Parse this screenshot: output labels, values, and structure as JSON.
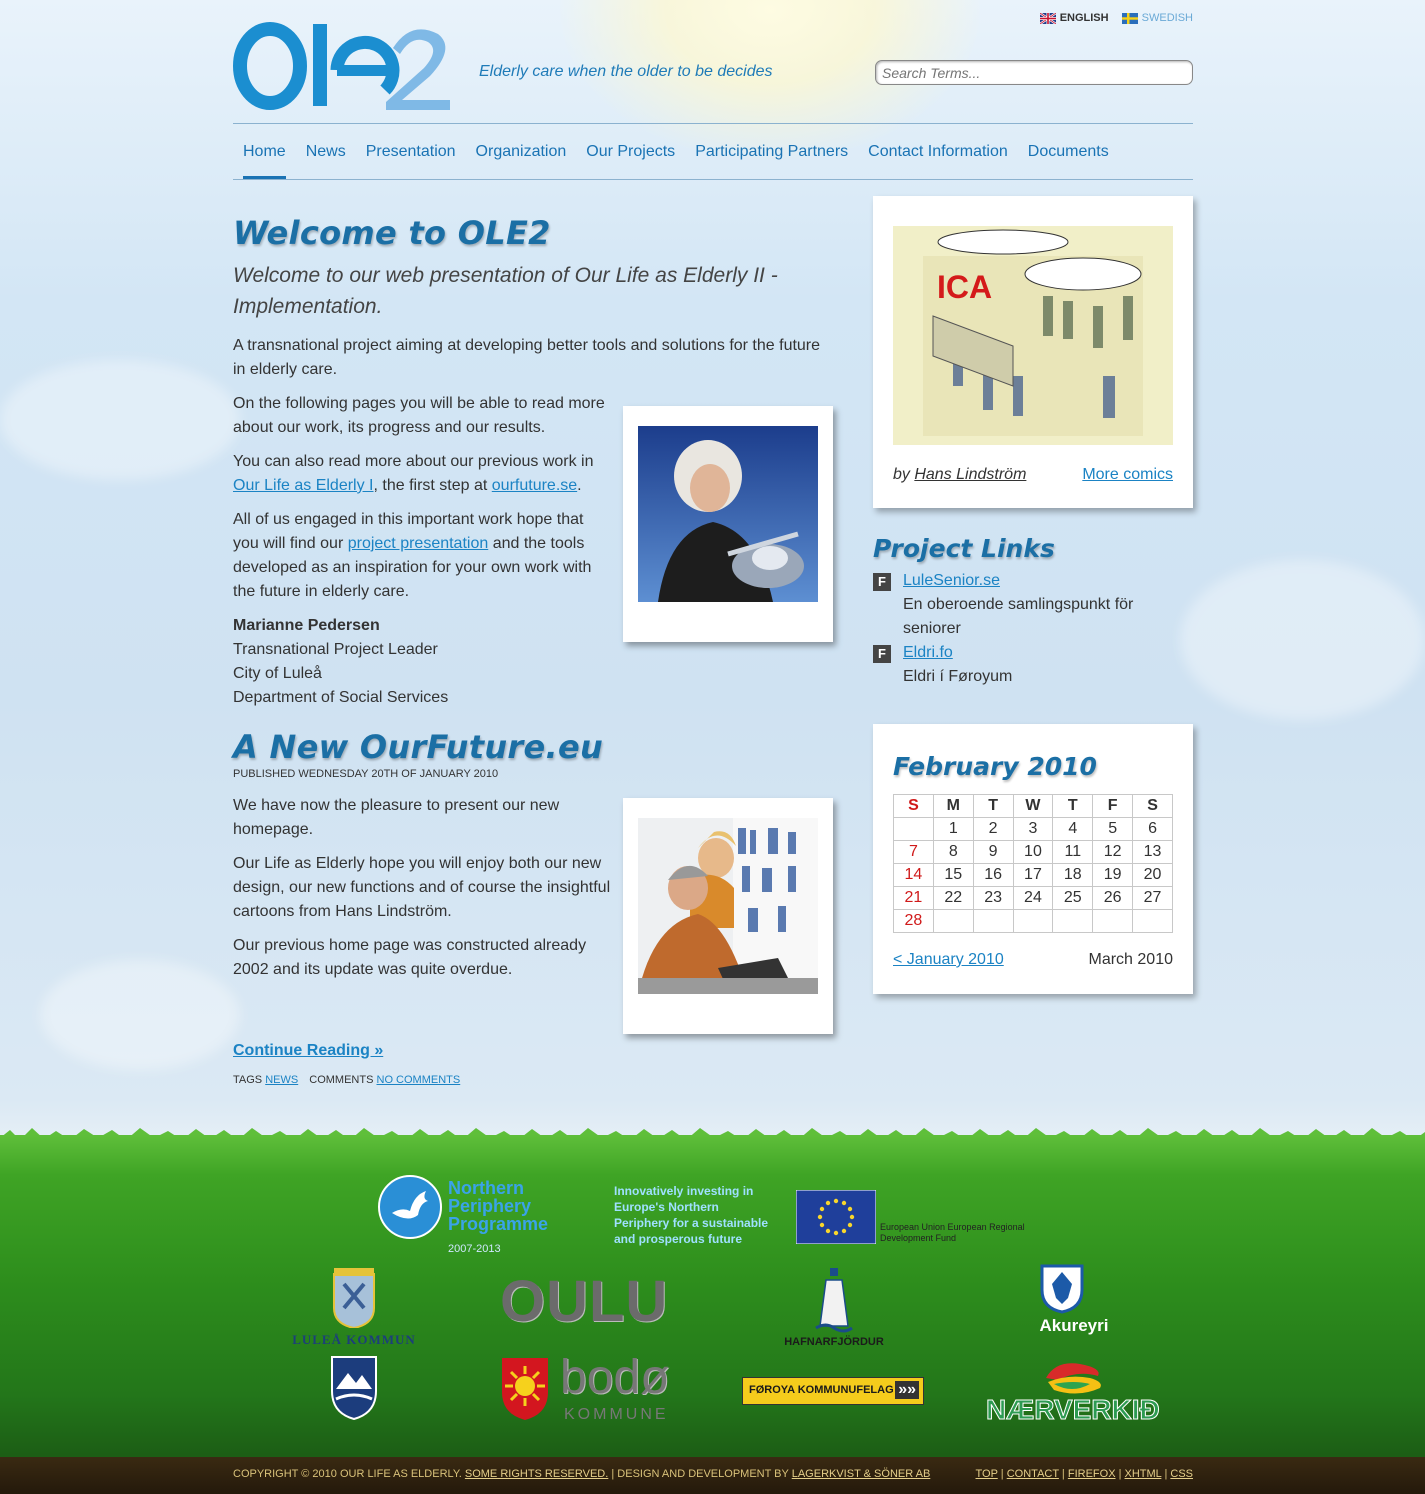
{
  "header": {
    "tagline": "Elderly care when the older to be decides",
    "languages": [
      "ENGLISH",
      "SWEDISH"
    ],
    "search_placeholder": "Search Terms..."
  },
  "nav": [
    "Home",
    "News",
    "Presentation",
    "Organization",
    "Our Projects",
    "Participating Partners",
    "Contact Information",
    "Documents"
  ],
  "post1": {
    "title": "Welcome to OLE2",
    "lead": "Welcome to our web presentation of Our Life as Elderly II - Implementation.",
    "p1": "A transnational project aiming at developing better tools and solutions for the future in elderly care.",
    "p2": "On the following pages you will be able to read more about our work, its progress and our results.",
    "p3_a": "You can also read more about our previous work in ",
    "p3_link1": "Our Life as Elderly I",
    "p3_b": ", the first step at ",
    "p3_link2": "ourfuture.se",
    "p3_c": ".",
    "p4_a": "All of us engaged in this important work hope that you will find our ",
    "p4_link": "project presentation",
    "p4_b": " and the tools developed as an inspiration for your own work with the future in elderly care.",
    "sig_name": "Marianne Pedersen",
    "sig_role": "Transnational Project Leader",
    "sig_city": "City of Luleå",
    "sig_dept": "Department of Social Services"
  },
  "post2": {
    "title": "A New OurFuture.eu",
    "published": "PUBLISHED WEDNESDAY 20TH OF JANUARY 2010",
    "p1": "We have now the pleasure to present our new homepage.",
    "p2": "Our Life as Elderly hope you will enjoy both our new design, our new functions and of course the insightful cartoons from Hans Lindström.",
    "p3": "Our previous home page was constructed already 2002 and its update was quite overdue.",
    "continue": "Continue Reading »",
    "tags_label": "TAGS",
    "tag": "NEWS",
    "comments_label": "COMMENTS",
    "comments": "NO COMMENTS"
  },
  "comic": {
    "by": "by ",
    "author": "Hans Lindström",
    "more": "More comics"
  },
  "project_links": {
    "title": "Project Links",
    "items": [
      {
        "link": "LuleSenior.se",
        "desc": "En oberoende samlingspunkt för seniorer"
      },
      {
        "link": "Eldri.fo",
        "desc": "Eldri í Føroyum"
      }
    ]
  },
  "calendar": {
    "title": "February 2010",
    "days": [
      "S",
      "M",
      "T",
      "W",
      "T",
      "F",
      "S"
    ],
    "weeks": [
      [
        "",
        "1",
        "2",
        "3",
        "4",
        "5",
        "6"
      ],
      [
        "7",
        "8",
        "9",
        "10",
        "11",
        "12",
        "13"
      ],
      [
        "14",
        "15",
        "16",
        "17",
        "18",
        "19",
        "20"
      ],
      [
        "21",
        "22",
        "23",
        "24",
        "25",
        "26",
        "27"
      ],
      [
        "28",
        "",
        "",
        "",
        "",
        "",
        ""
      ]
    ],
    "prev": "< January 2010",
    "next": "March 2010"
  },
  "sponsors": {
    "npp": "Northern Periphery Programme",
    "npp_years": "2007-2013",
    "npp_slogan": "Innovatively investing in Europe's Northern Periphery for a sustainable and prosperous future",
    "eu": "European Union European Regional Development Fund",
    "lulea": "LULEÅ KOMMUN",
    "oulu": "OULU",
    "hafnarfjordur": "HAFNARFJÖRDUR",
    "akureyri": "Akureyri",
    "bodo": "bodø",
    "bodo_sub": "KOMMUNE",
    "foroya": "FØROYA KOMMUNUFELAG",
    "naerverkid": "NÆRVERKIÐ"
  },
  "footer": {
    "copyright": "COPYRIGHT © 2010 OUR LIFE AS ELDERLY.",
    "rights": "SOME RIGHTS RESERVED.",
    "design": "| DESIGN AND DEVELOPMENT BY",
    "designer": "LAGERKVIST & SÖNER AB",
    "links": [
      "TOP",
      "CONTACT",
      "FIREFOX",
      "XHTML",
      "CSS"
    ]
  },
  "colors": {
    "accent": "#1b83c4",
    "title": "#1b6fa5",
    "grass": "#2d8d1c"
  }
}
